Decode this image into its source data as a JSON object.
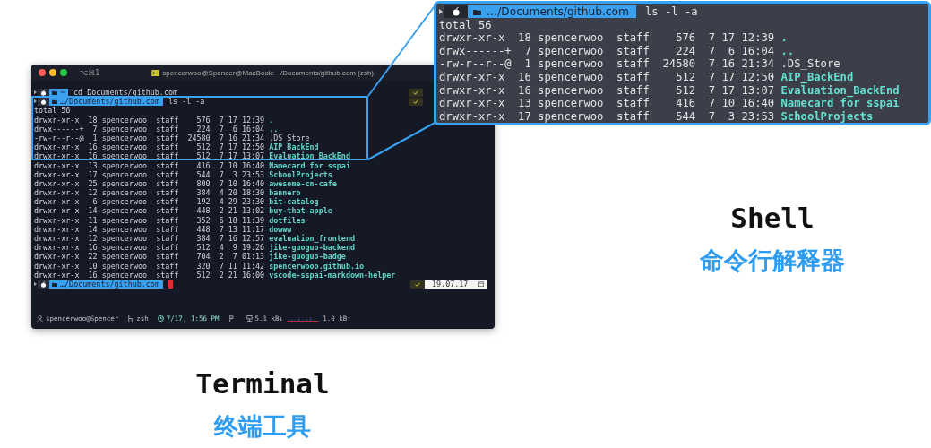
{
  "terminal": {
    "shortcut": "⌥⌘1",
    "title": "spencerwoo@Spencer@MacBook: ~/Documents/github.com (zsh)",
    "lines": [
      {
        "kind": "prompt",
        "path": "~",
        "command": "cd Documents/github.com"
      },
      {
        "kind": "prompt",
        "path": "…/Documents/github.com",
        "command": "ls -l -a"
      },
      {
        "kind": "text",
        "text": "total 56"
      },
      {
        "kind": "entry",
        "meta": "drwxr-xr-x  18 spencerwoo  staff    576  7 17 12:39",
        "name": ".",
        "is_dir": true
      },
      {
        "kind": "entry",
        "meta": "drwx------+  7 spencerwoo  staff    224  7  6 16:04",
        "name": "..",
        "is_dir": true
      },
      {
        "kind": "entry",
        "meta": "-rw-r--r--@  1 spencerwoo  staff  24580  7 16 21:34",
        "name": ".DS_Store",
        "is_dir": false
      },
      {
        "kind": "entry",
        "meta": "drwxr-xr-x  16 spencerwoo  staff    512  7 17 12:50",
        "name": "AIP_BackEnd",
        "is_dir": true
      },
      {
        "kind": "entry",
        "meta": "drwxr-xr-x  16 spencerwoo  staff    512  7 17 13:07",
        "name": "Evaluation_BackEnd",
        "is_dir": true
      },
      {
        "kind": "entry",
        "meta": "drwxr-xr-x  13 spencerwoo  staff    416  7 10 16:40",
        "name": "Namecard for sspai",
        "is_dir": true
      },
      {
        "kind": "entry",
        "meta": "drwxr-xr-x  17 spencerwoo  staff    544  7  3 23:53",
        "name": "SchoolProjects",
        "is_dir": true
      },
      {
        "kind": "entry",
        "meta": "drwxr-xr-x  25 spencerwoo  staff    800  7 10 16:40",
        "name": "awesome-cn-cafe",
        "is_dir": true
      },
      {
        "kind": "entry",
        "meta": "drwxr-xr-x  12 spencerwoo  staff    384  4 20 18:30",
        "name": "bannero",
        "is_dir": true
      },
      {
        "kind": "entry",
        "meta": "drwxr-xr-x   6 spencerwoo  staff    192  4 29 23:30",
        "name": "bit-catalog",
        "is_dir": true
      },
      {
        "kind": "entry",
        "meta": "drwxr-xr-x  14 spencerwoo  staff    448  2 21 13:02",
        "name": "buy-that-apple",
        "is_dir": true
      },
      {
        "kind": "entry",
        "meta": "drwxr-xr-x  11 spencerwoo  staff    352  6 18 11:39",
        "name": "dotfiles",
        "is_dir": true
      },
      {
        "kind": "entry",
        "meta": "drwxr-xr-x  14 spencerwoo  staff    448  7 13 11:17",
        "name": "dowww",
        "is_dir": true
      },
      {
        "kind": "entry",
        "meta": "drwxr-xr-x  12 spencerwoo  staff    384  7 16 12:57",
        "name": "evaluation_frontend",
        "is_dir": true
      },
      {
        "kind": "entry",
        "meta": "drwxr-xr-x  16 spencerwoo  staff    512  4  9 19:26",
        "name": "jike-guoguo-backend",
        "is_dir": true
      },
      {
        "kind": "entry",
        "meta": "drwxr-xr-x  22 spencerwoo  staff    704  2  7 01:13",
        "name": "jike-guoguo-badge",
        "is_dir": true
      },
      {
        "kind": "entry",
        "meta": "drwxr-xr-x  10 spencerwoo  staff    320  7 11 11:42",
        "name": "spencerwooo.github.io",
        "is_dir": true
      },
      {
        "kind": "entry",
        "meta": "drwxr-xr-x  16 spencerwoo  staff    512  2 21 16:00",
        "name": "vscode-sspai-markdown-helper",
        "is_dir": true
      }
    ],
    "current_prompt": {
      "path": "…/Documents/github.com",
      "date": "19.07.17"
    },
    "status_bar": {
      "user": "spencerwoo@Spencer",
      "shell": "zsh",
      "time": "7/17, 1:56 PM",
      "download": "5.1 kB↓",
      "upload": "1.0 kB↑"
    }
  },
  "callout": {
    "lines": [
      {
        "kind": "prompt",
        "path": "…/Documents/github.com",
        "command": "ls -l -a"
      },
      {
        "kind": "text",
        "text": "total 56"
      },
      {
        "kind": "entry",
        "meta": "drwxr-xr-x  18 spencerwoo  staff    576  7 17 12:39",
        "name": ".",
        "is_dir": true
      },
      {
        "kind": "entry",
        "meta": "drwx------+  7 spencerwoo  staff    224  7  6 16:04",
        "name": "..",
        "is_dir": true
      },
      {
        "kind": "entry",
        "meta": "-rw-r--r--@  1 spencerwoo  staff  24580  7 16 21:34",
        "name": ".DS_Store",
        "is_dir": false
      },
      {
        "kind": "entry",
        "meta": "drwxr-xr-x  16 spencerwoo  staff    512  7 17 12:50",
        "name": "AIP_BackEnd",
        "is_dir": true
      },
      {
        "kind": "entry",
        "meta": "drwxr-xr-x  16 spencerwoo  staff    512  7 17 13:07",
        "name": "Evaluation_BackEnd",
        "is_dir": true
      },
      {
        "kind": "entry",
        "meta": "drwxr-xr-x  13 spencerwoo  staff    416  7 10 16:40",
        "name": "Namecard for sspai",
        "is_dir": true
      },
      {
        "kind": "entry",
        "meta": "drwxr-xr-x  17 spencerwoo  staff    544  7  3 23:53",
        "name": "SchoolProjects",
        "is_dir": true
      }
    ]
  },
  "labels": [
    {
      "kind": "terminal",
      "title": "Terminal",
      "subtitle": "终端工具"
    },
    {
      "kind": "shell",
      "title": "Shell",
      "subtitle": "命令行解释器"
    }
  ]
}
